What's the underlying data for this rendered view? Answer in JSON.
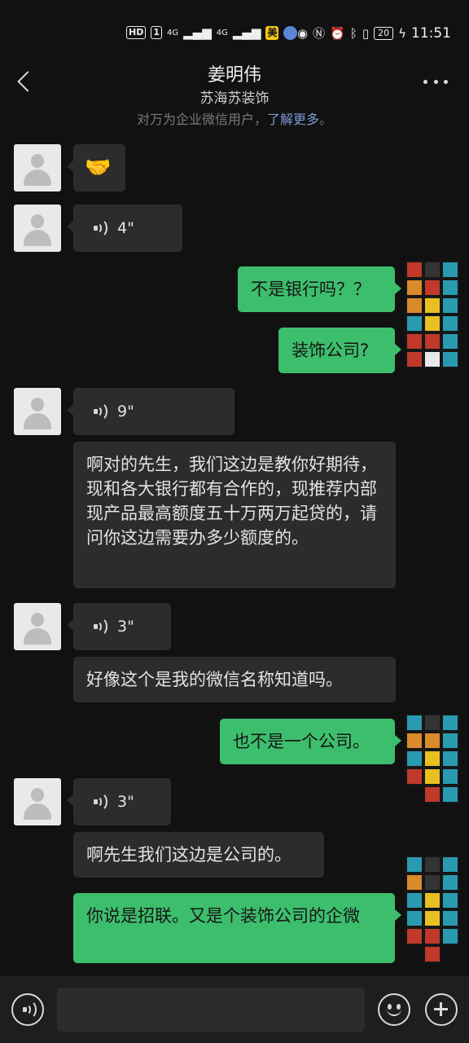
{
  "status_bar": {
    "hd": "HD",
    "sim1": "1",
    "net1": "4G",
    "net2": "4G",
    "app_badge": "美",
    "battery": "20",
    "time": "11:51"
  },
  "header": {
    "title": "姜明伟",
    "subtitle": "苏海苏装饰",
    "notice_prefix": "对万为企业微信用户，",
    "notice_link": "了解更多",
    "notice_suffix": "。"
  },
  "messages": [
    {
      "side": "in",
      "type": "emoji",
      "content": "🤝"
    },
    {
      "side": "in",
      "type": "voice",
      "duration": "4\""
    },
    {
      "side": "out",
      "type": "text",
      "content": "不是银行吗？？"
    },
    {
      "side": "out",
      "type": "text",
      "content": "装饰公司?"
    },
    {
      "side": "in",
      "type": "voice",
      "duration": "9\""
    },
    {
      "side": "in",
      "type": "text",
      "content": "啊对的先生，我们这边是教你好期待，现和各大银行都有合作的，现推荐内部现产品最高额度五十万两万起贷的，请问你这边需要办多少额度的。"
    },
    {
      "side": "in",
      "type": "voice",
      "duration": "3\""
    },
    {
      "side": "in",
      "type": "text",
      "content": "好像这个是我的微信名称知道吗。"
    },
    {
      "side": "out",
      "type": "text",
      "content": "也不是一个公司。"
    },
    {
      "side": "in",
      "type": "voice",
      "duration": "3\""
    },
    {
      "side": "in",
      "type": "text",
      "content": "啊先生我们这边是公司的。"
    },
    {
      "side": "out",
      "type": "text",
      "content": "你说是招联。又是个装饰公司的企微"
    }
  ],
  "input": {
    "placeholder": ""
  },
  "colors": {
    "background": "#111111",
    "incoming_bubble": "#2c2c2c",
    "outgoing_bubble": "#3dbe6d",
    "link": "#7a9ad6"
  },
  "icons": [
    "back-icon",
    "more-icon",
    "voice-icon",
    "emoji-icon",
    "plus-icon",
    "default-avatar-icon"
  ]
}
